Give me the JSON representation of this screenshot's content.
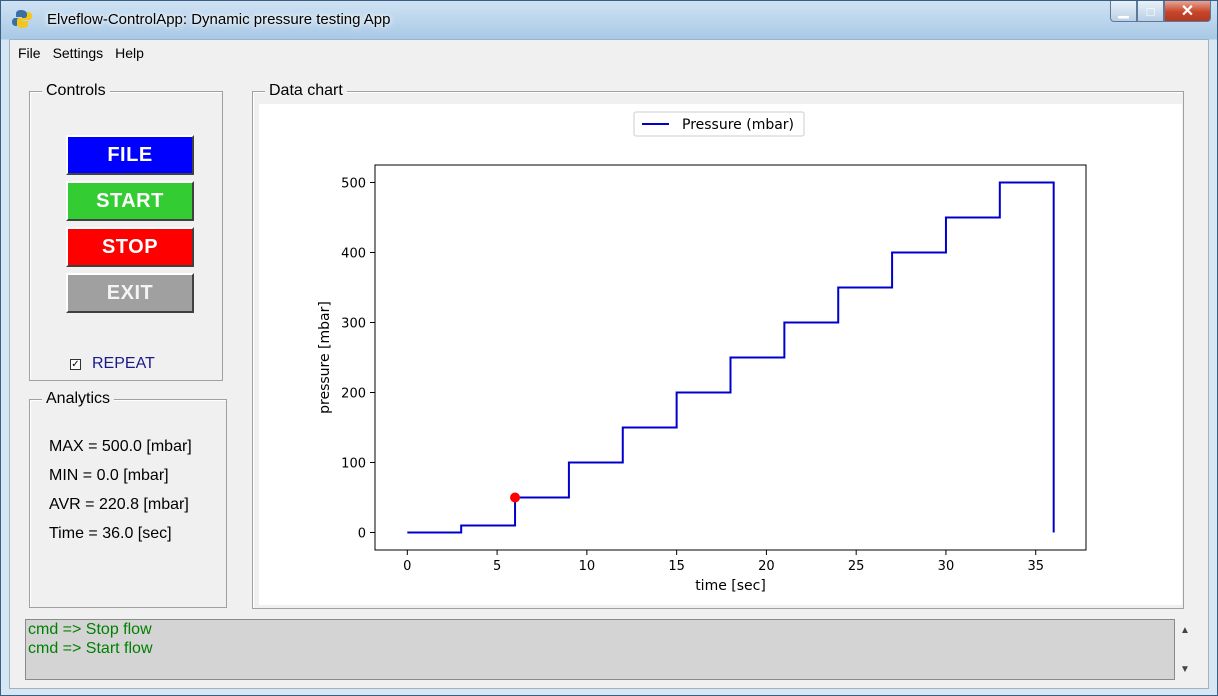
{
  "window": {
    "title": "Elveflow-ControlApp: Dynamic pressure testing App"
  },
  "menu": [
    "File",
    "Settings",
    "Help"
  ],
  "controls": {
    "title": "Controls",
    "file_label": "FILE",
    "start_label": "START",
    "stop_label": "STOP",
    "exit_label": "EXIT",
    "repeat_label": "REPEAT",
    "repeat_checked": true
  },
  "analytics": {
    "title": "Analytics",
    "max": "MAX = 500.0 [mbar]",
    "min": "MIN = 0.0 [mbar]",
    "avr": "AVR = 220.8 [mbar]",
    "time": "Time = 36.0 [sec]"
  },
  "data_chart": {
    "title": "Data chart"
  },
  "chart_data": {
    "type": "line",
    "legend": "Pressure (mbar)",
    "legend_position": "top-center",
    "xlabel": "time [sec]",
    "ylabel": "pressure [mbar]",
    "xlim": [
      -1.8,
      37.8
    ],
    "ylim": [
      -25,
      525
    ],
    "xticks": [
      0,
      5,
      10,
      15,
      20,
      25,
      30,
      35
    ],
    "yticks": [
      0,
      100,
      200,
      300,
      400,
      500
    ],
    "line_color": "#0000cc",
    "marker_color": "#ff0000",
    "marker": {
      "x": 6,
      "y": 50
    },
    "points": [
      [
        0,
        0
      ],
      [
        3,
        0
      ],
      [
        3,
        10
      ],
      [
        6,
        10
      ],
      [
        6,
        50
      ],
      [
        9,
        50
      ],
      [
        9,
        100
      ],
      [
        12,
        100
      ],
      [
        12,
        150
      ],
      [
        15,
        150
      ],
      [
        15,
        200
      ],
      [
        18,
        200
      ],
      [
        18,
        250
      ],
      [
        21,
        250
      ],
      [
        21,
        300
      ],
      [
        24,
        300
      ],
      [
        24,
        350
      ],
      [
        27,
        350
      ],
      [
        27,
        400
      ],
      [
        30,
        400
      ],
      [
        30,
        450
      ],
      [
        33,
        450
      ],
      [
        33,
        500
      ],
      [
        36,
        500
      ],
      [
        36,
        0
      ]
    ]
  },
  "console": {
    "lines": [
      "cmd =>  Stop flow",
      "cmd =>  Start flow"
    ]
  },
  "colors": {
    "file": "#0000ff",
    "start": "#33cc33",
    "stop": "#ff0000",
    "exit": "#a0a0a0",
    "console_text": "#008000"
  }
}
